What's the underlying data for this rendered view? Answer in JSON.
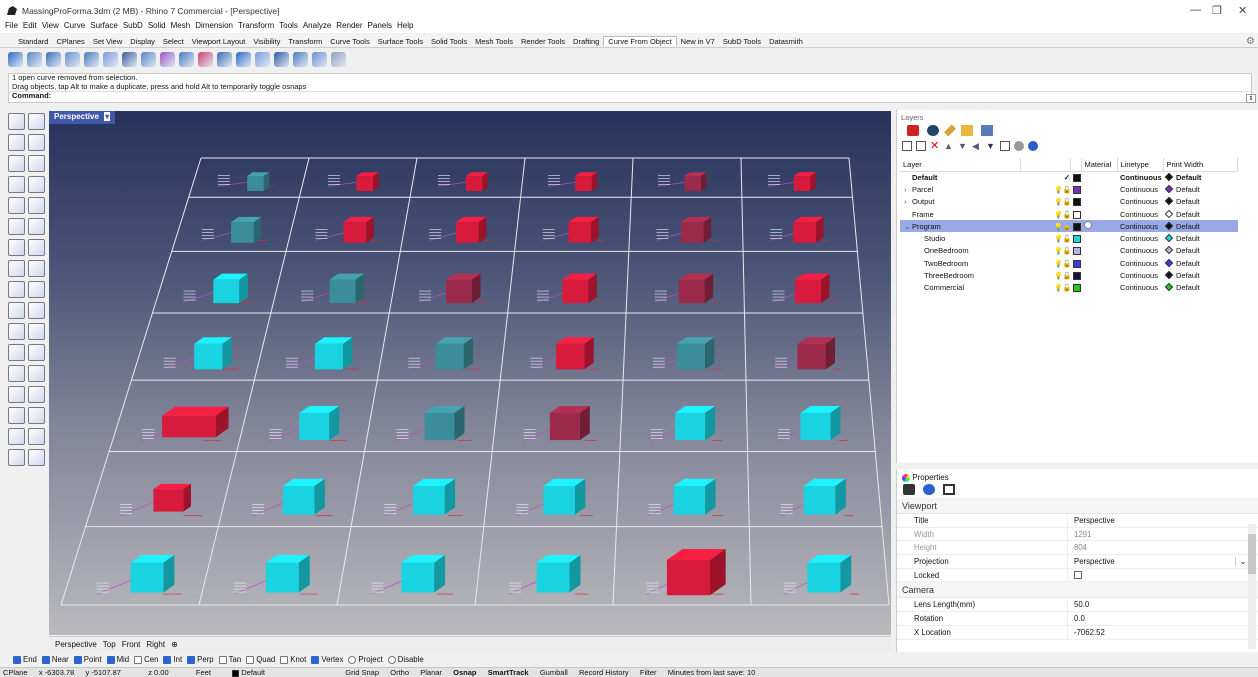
{
  "title_bar": {
    "title": "MassingProForma.3dm (2 MB) - Rhino 7 Commercial - [Perspective]",
    "min": "—",
    "max": "❐",
    "close": "✕"
  },
  "menu": [
    "File",
    "Edit",
    "View",
    "Curve",
    "Surface",
    "SubD",
    "Solid",
    "Mesh",
    "Dimension",
    "Transform",
    "Tools",
    "Analyze",
    "Render",
    "Panels",
    "Help"
  ],
  "toolbar_tabs": [
    "Standard",
    "CPlanes",
    "Set View",
    "Display",
    "Select",
    "Viewport Layout",
    "Visibility",
    "Transform",
    "Curve Tools",
    "Surface Tools",
    "Solid Tools",
    "Mesh Tools",
    "Render Tools",
    "Drafting",
    "Curve From Object",
    "New in V7",
    "SubD Tools",
    "Datasmith"
  ],
  "active_tab": "Curve From Object",
  "command": {
    "line1": "1 open curve removed from selection.",
    "line2": "Drag objects, tap Alt to make a duplicate, press and hold Alt to temporarily toggle osnaps",
    "prompt": "Command:"
  },
  "viewport": {
    "name": "Perspective",
    "tabs": [
      "Perspective",
      "Top",
      "Front",
      "Right"
    ],
    "add": "⊕"
  },
  "osnaps": [
    {
      "label": "End",
      "on": true
    },
    {
      "label": "Near",
      "on": true
    },
    {
      "label": "Point",
      "on": true
    },
    {
      "label": "Mid",
      "on": true
    },
    {
      "label": "Cen",
      "on": false
    },
    {
      "label": "Int",
      "on": true
    },
    {
      "label": "Perp",
      "on": true
    },
    {
      "label": "Tan",
      "on": false
    },
    {
      "label": "Quad",
      "on": false
    },
    {
      "label": "Knot",
      "on": false
    },
    {
      "label": "Vertex",
      "on": true
    },
    {
      "label": "Project",
      "on": false,
      "radio": true
    },
    {
      "label": "Disable",
      "on": false,
      "radio": true
    }
  ],
  "status": {
    "cplane": "CPlane",
    "x": "x -6303.78",
    "y": "y -5107.87",
    "z": "z 0.00",
    "units": "Feet",
    "layer": "Default",
    "grid_snap": "Grid Snap",
    "ortho": "Ortho",
    "planar": "Planar",
    "osnap": "Osnap",
    "smarttrack": "SmartTrack",
    "gumball": "Gumball",
    "record": "Record History",
    "filter": "Filter",
    "save": "Minutes from last save: 10"
  },
  "layers": {
    "panel_title": "Layers",
    "headers": {
      "layer": "Layer",
      "material": "Material",
      "linetype": "Linetype",
      "print_width": "Print Width",
      "check": "✓"
    },
    "rows": [
      {
        "name": "Default",
        "indent": 0,
        "expander": "",
        "current": true,
        "color": "#111111",
        "linetype": "Continuous",
        "print": "Default",
        "diamond": "#111111",
        "bold": true
      },
      {
        "name": "Parcel",
        "indent": 0,
        "expander": "›",
        "color": "#7b2fbf",
        "linetype": "Continuous",
        "print": "Default",
        "diamond": "#7b2fbf"
      },
      {
        "name": "Output",
        "indent": 0,
        "expander": "›",
        "color": "#111111",
        "linetype": "Continuous",
        "print": "Default",
        "diamond": "#111111"
      },
      {
        "name": "Frame",
        "indent": 0,
        "expander": "",
        "color": "#ffffff",
        "linetype": "Continuous",
        "print": "Default",
        "diamond": "#ffffff"
      },
      {
        "name": "Program",
        "indent": 0,
        "expander": "⌄",
        "color": "#111111",
        "linetype": "Continuous",
        "print": "Default",
        "diamond": "#111111",
        "selected": true
      },
      {
        "name": "Studio",
        "indent": 1,
        "expander": "",
        "color": "#22d6d6",
        "linetype": "Continuous",
        "print": "Default",
        "diamond": "#22d6d6"
      },
      {
        "name": "OneBedroom",
        "indent": 1,
        "expander": "",
        "color": "#b9b0e6",
        "linetype": "Continuous",
        "print": "Default",
        "diamond": "#b9b0e6"
      },
      {
        "name": "TwoBedroom",
        "indent": 1,
        "expander": "",
        "color": "#3a3adf",
        "linetype": "Continuous",
        "print": "Default",
        "diamond": "#3a3adf"
      },
      {
        "name": "ThreeBedroom",
        "indent": 1,
        "expander": "",
        "color": "#111133",
        "linetype": "Continuous",
        "print": "Default",
        "diamond": "#111133"
      },
      {
        "name": "Commercial",
        "indent": 1,
        "expander": "",
        "color": "#1fc41f",
        "linetype": "Continuous",
        "print": "Default",
        "diamond": "#1fc41f"
      }
    ]
  },
  "properties": {
    "panel_title": "Properties",
    "section_viewport": "Viewport",
    "section_camera": "Camera",
    "viewport_rows": [
      {
        "k": "Title",
        "v": "Perspective"
      },
      {
        "k": "Width",
        "v": "1291",
        "dim": true
      },
      {
        "k": "Height",
        "v": "804",
        "dim": true
      },
      {
        "k": "Projection",
        "v": "Perspective",
        "dropdown": true
      },
      {
        "k": "Locked",
        "v": "",
        "checkbox": true
      }
    ],
    "camera_rows": [
      {
        "k": "Lens Length(mm)",
        "v": "50.0"
      },
      {
        "k": "Rotation",
        "v": "0.0"
      },
      {
        "k": "X Location",
        "v": "-7062.52"
      }
    ]
  },
  "colors": {
    "red": "#d81b3c",
    "cyan": "#19d3e0",
    "teal": "#3c8d9a",
    "maroon": "#9c2a4a",
    "selection": "#98a9e6",
    "accent": "#3f58a8"
  }
}
